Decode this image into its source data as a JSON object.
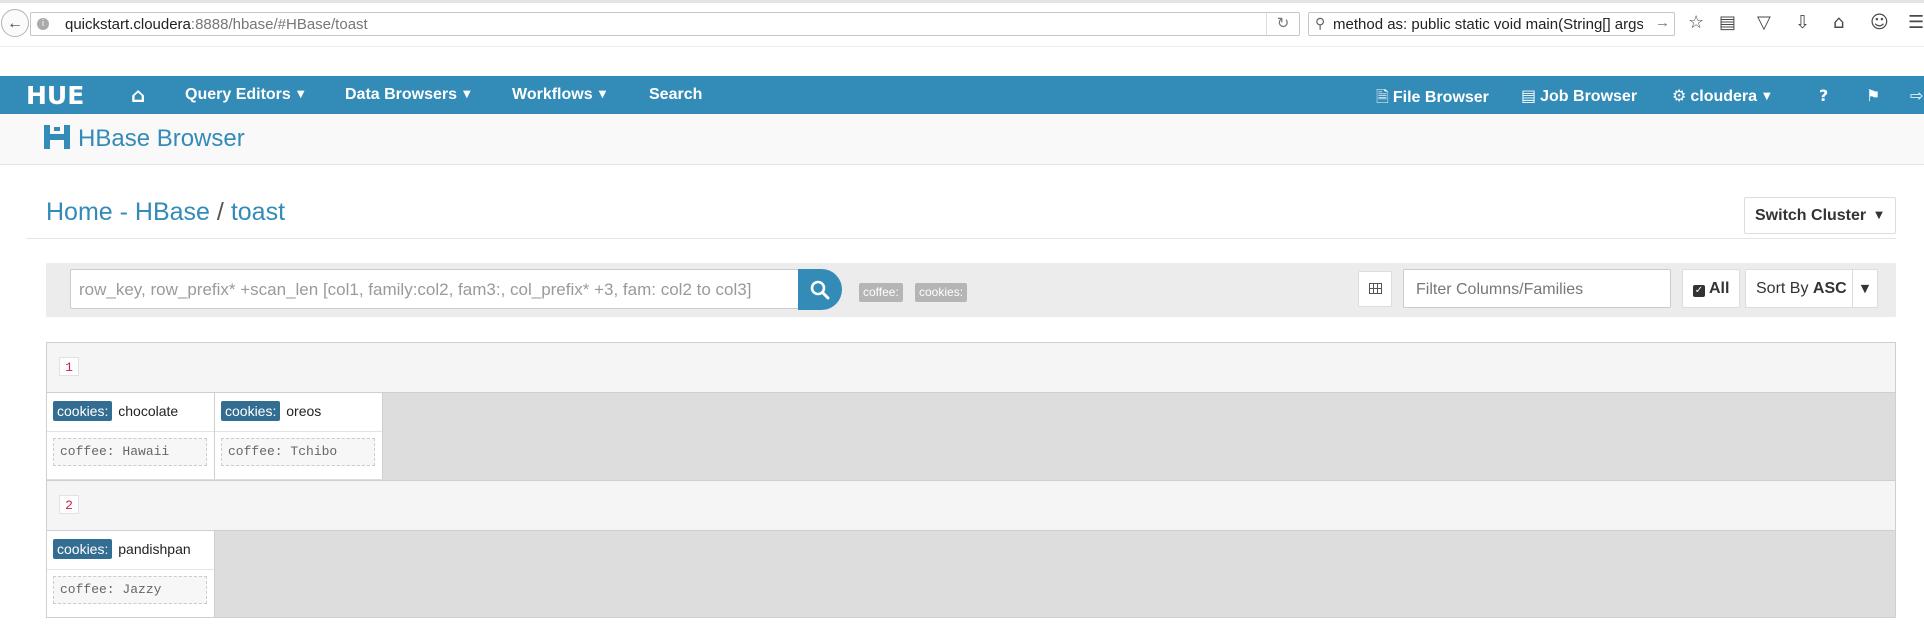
{
  "browser": {
    "url_host": "quickstart.cloudera",
    "url_rest": ":8888/hbase/#HBase/toast",
    "search_text": "method as:    public static void main(String[] args)"
  },
  "nav": {
    "logo": "HUE",
    "items": [
      {
        "label": "Query Editors"
      },
      {
        "label": "Data Browsers"
      },
      {
        "label": "Workflows"
      },
      {
        "label": "Search"
      }
    ],
    "right": {
      "file_browser": "File Browser",
      "job_browser": "Job Browser",
      "user": "cloudera"
    }
  },
  "app": {
    "title": "HBase Browser"
  },
  "breadcrumb": {
    "home": "Home",
    "cluster": "HBase",
    "table": "toast"
  },
  "switch_cluster": "Switch Cluster",
  "search": {
    "placeholder": "row_key, row_prefix* +scan_len [col1, family:col2, fam3:, col_prefix* +3, fam: col2 to col3]",
    "families": [
      "coffee:",
      "cookies:"
    ]
  },
  "filter_placeholder": "Filter Columns/Families",
  "all_label": "All",
  "sort": {
    "label": "Sort By",
    "value": "ASC"
  },
  "rows": [
    {
      "key": "1",
      "cells": [
        {
          "family": "cookies:",
          "qualifier": "chocolate",
          "value": "coffee: Hawaii"
        },
        {
          "family": "cookies:",
          "qualifier": "oreos",
          "value": "coffee: Tchibo"
        }
      ]
    },
    {
      "key": "2",
      "cells": [
        {
          "family": "cookies:",
          "qualifier": "pandishpan",
          "value": "coffee: Jazzy"
        }
      ]
    }
  ],
  "colors": {
    "nav_bg": "#338bb8",
    "family_badge": "#336e92",
    "rowkey_text": "#c7254e"
  }
}
